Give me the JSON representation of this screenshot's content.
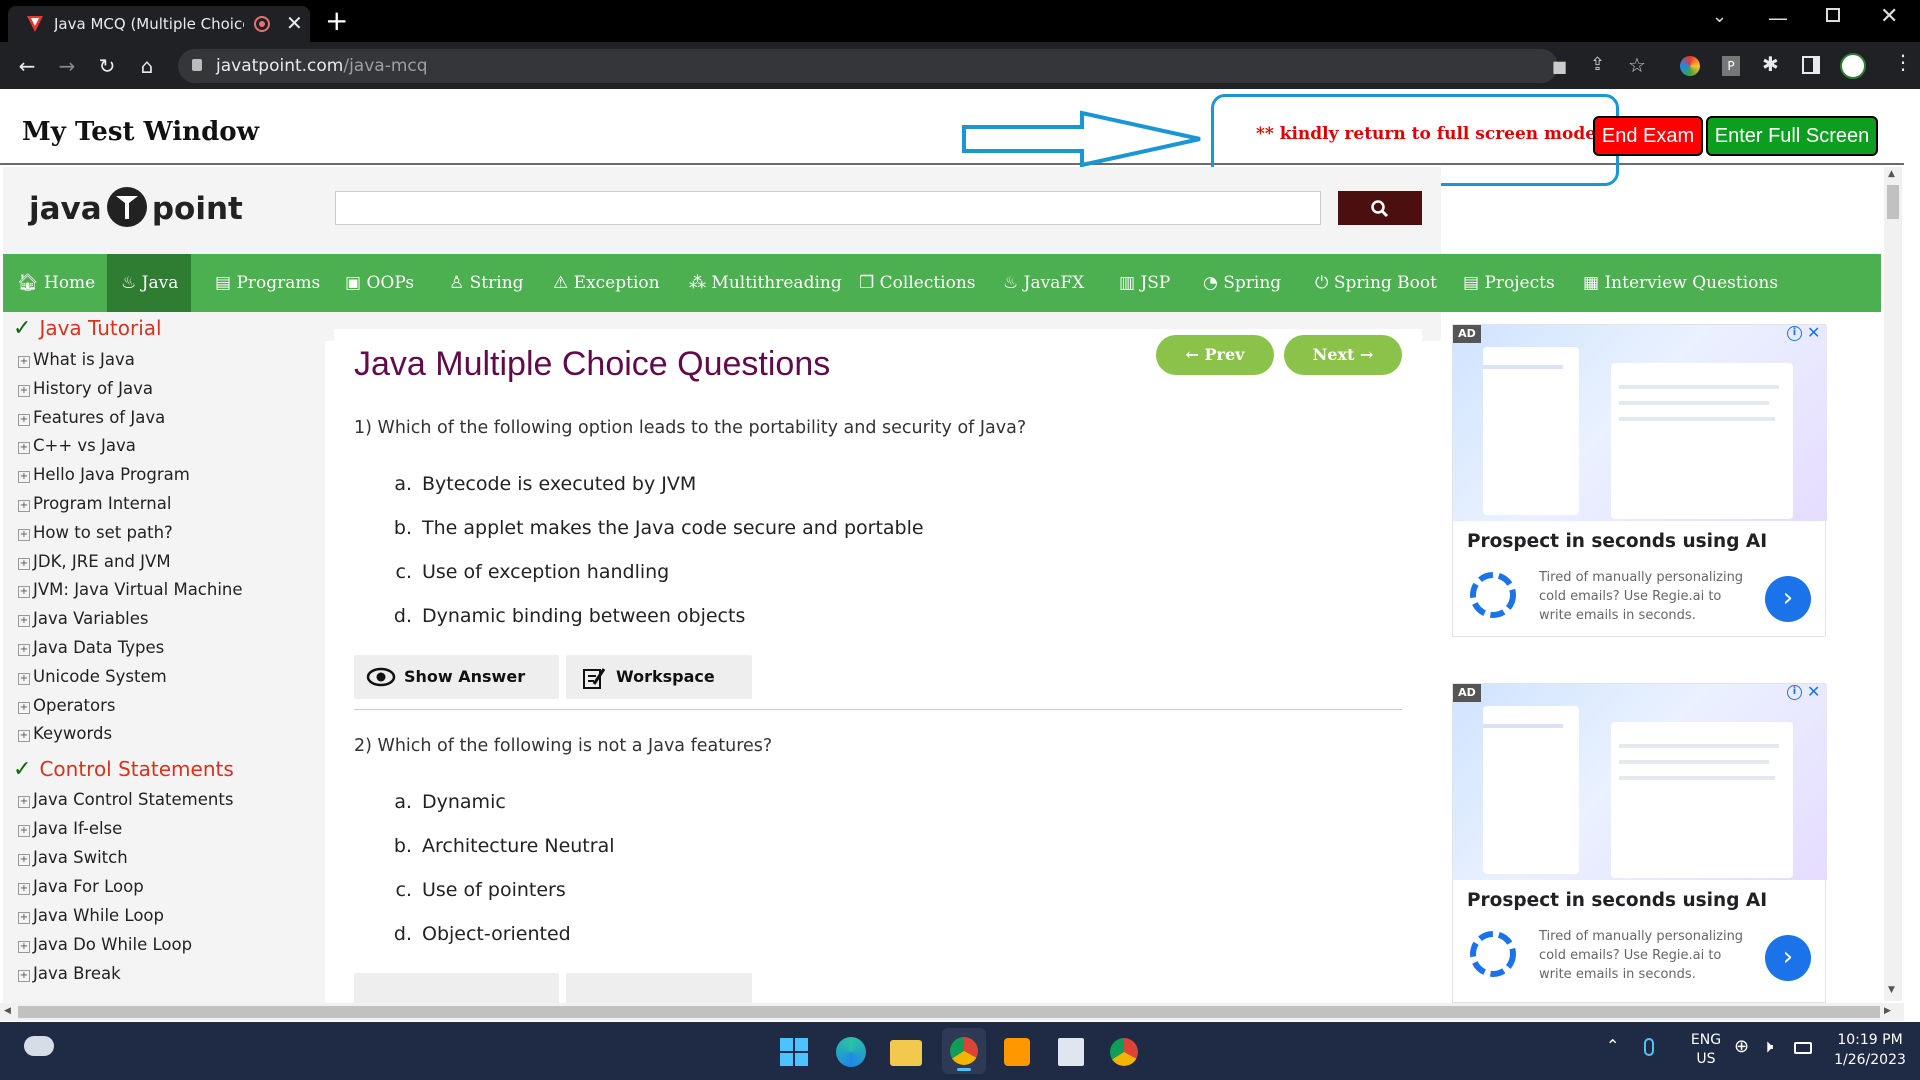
{
  "browser": {
    "tab_title": "Java MCQ (Multiple Choice C",
    "url_host": "javatpoint.com",
    "url_path": "/java-mcq"
  },
  "test_window": {
    "title": "My Test Window",
    "warning": "** kindly return to full screen mode **",
    "end_exam": "End Exam",
    "enter_full_screen": "Enter Full Screen"
  },
  "site": {
    "logo_left": "java",
    "logo_right": "point",
    "nav": [
      "Home",
      "Java",
      "Programs",
      "OOPs",
      "String",
      "Exception",
      "Multithreading",
      "Collections",
      "JavaFX",
      "JSP",
      "Spring",
      "Spring Boot",
      "Projects",
      "Interview Questions"
    ]
  },
  "sidebar": {
    "section1": "Java Tutorial",
    "items1": [
      "What is Java",
      "History of Java",
      "Features of Java",
      "C++ vs Java",
      "Hello Java Program",
      "Program Internal",
      "How to set path?",
      "JDK, JRE and JVM",
      "JVM: Java Virtual Machine",
      "Java Variables",
      "Java Data Types",
      "Unicode System",
      "Operators",
      "Keywords"
    ],
    "section2": "Control Statements",
    "items2": [
      "Java Control Statements",
      "Java If-else",
      "Java Switch",
      "Java For Loop",
      "Java While Loop",
      "Java Do While Loop",
      "Java Break"
    ]
  },
  "main": {
    "heading": "Java Multiple Choice Questions",
    "prev": "← Prev",
    "next": "Next →",
    "q1": "1) Which of the following option leads to the portability and security of Java?",
    "q1_options": [
      {
        "letter": "a.",
        "text": "Bytecode is executed by JVM"
      },
      {
        "letter": "b.",
        "text": "The applet makes the Java code secure and portable"
      },
      {
        "letter": "c.",
        "text": "Use of exception handling"
      },
      {
        "letter": "d.",
        "text": "Dynamic binding between objects"
      }
    ],
    "show_answer": "Show Answer",
    "workspace": "Workspace",
    "q2": "2) Which of the following is not a Java features?",
    "q2_options": [
      {
        "letter": "a.",
        "text": "Dynamic"
      },
      {
        "letter": "b.",
        "text": "Architecture Neutral"
      },
      {
        "letter": "c.",
        "text": "Use of pointers"
      },
      {
        "letter": "d.",
        "text": "Object-oriented"
      }
    ]
  },
  "ads": [
    {
      "badge": "AD",
      "title": "Prospect in seconds using AI",
      "body": "Tired of manually personalizing cold emails? Use Regie.ai to write emails in seconds."
    },
    {
      "badge": "AD",
      "title": "Prospect in seconds using AI",
      "body": "Tired of manually personalizing cold emails? Use Regie.ai to write emails in seconds."
    }
  ],
  "taskbar": {
    "lang_top": "ENG",
    "lang_bottom": "US",
    "time": "10:19 PM",
    "date": "1/26/2023"
  },
  "colors": {
    "nav_green": "#4caf50",
    "nav_active": "#2e7d32",
    "heading": "#610b4b",
    "end_exam_red": "#ff0000",
    "full_screen_green": "#0c9e1e",
    "callout_blue": "#1a96d4"
  }
}
